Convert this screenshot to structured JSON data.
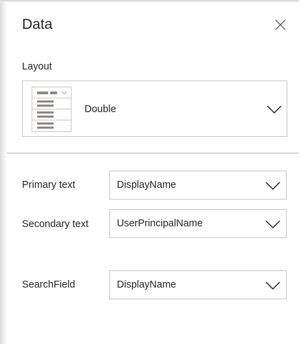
{
  "panel": {
    "title": "Data",
    "close_icon": "close-icon"
  },
  "layout": {
    "label": "Layout",
    "selected": "Double",
    "thumbnail_icon": "layout-double-thumbnail-icon"
  },
  "fields": [
    {
      "label": "Primary text",
      "value": "DisplayName"
    },
    {
      "label": "Secondary text",
      "value": "UserPrincipalName"
    },
    {
      "label": "SearchField",
      "value": "DisplayName"
    }
  ],
  "colors": {
    "text": "#252423",
    "border": "#c8c6c4",
    "divider": "#b3b0ad",
    "icon": "#605e5c"
  }
}
